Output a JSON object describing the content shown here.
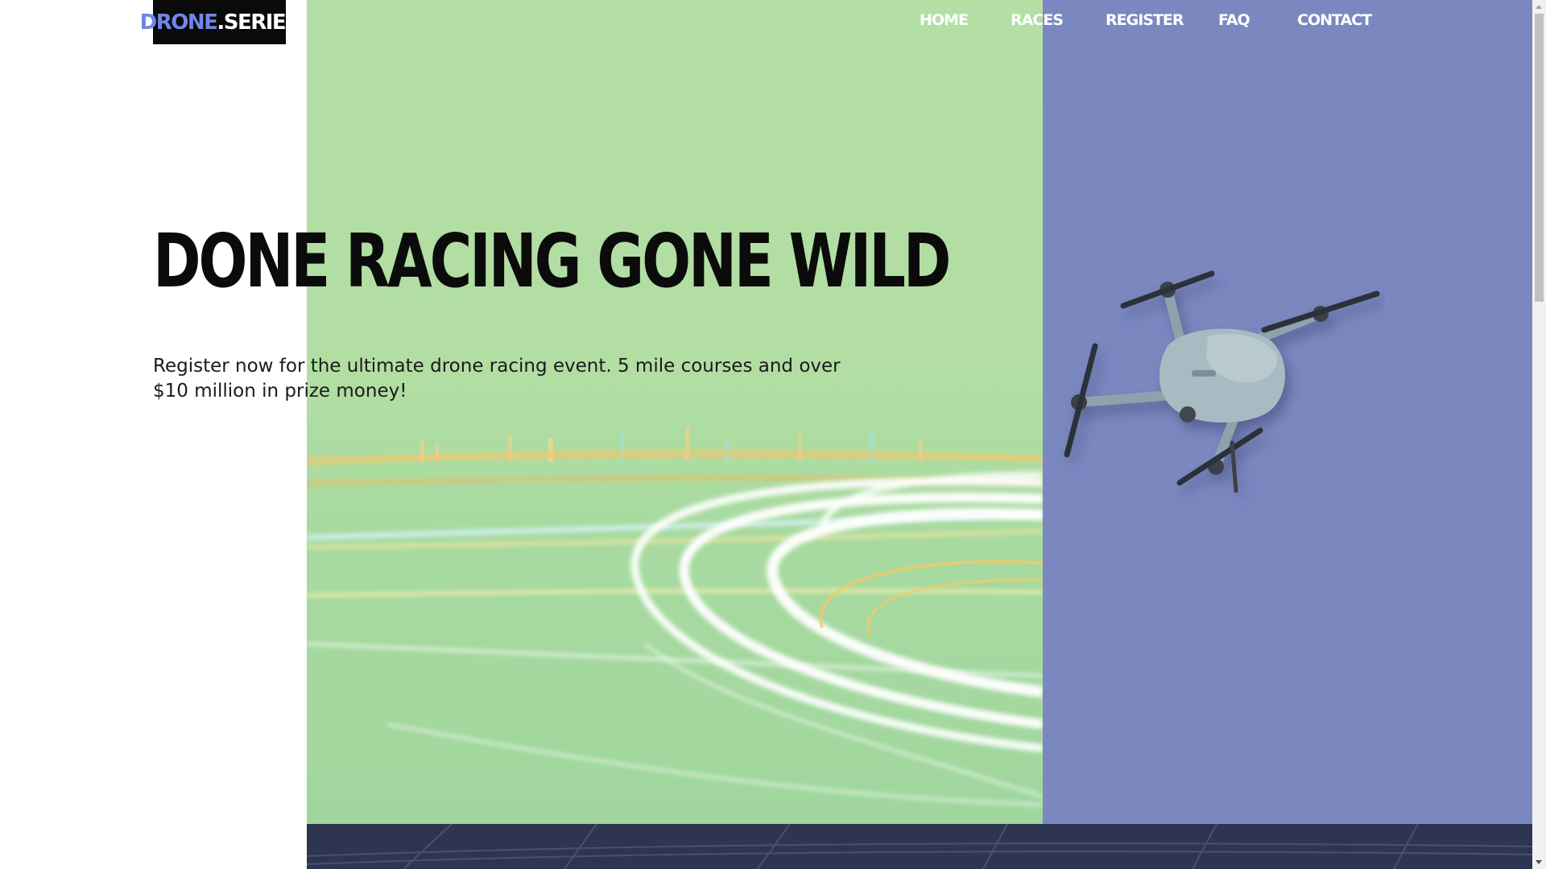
{
  "logo": {
    "part1": "DRONE",
    "part2": ".SERIES"
  },
  "nav": {
    "items": [
      {
        "label": "HOME"
      },
      {
        "label": "RACES"
      },
      {
        "label": "REGISTER"
      },
      {
        "label": "FAQ"
      },
      {
        "label": "CONTACT"
      }
    ]
  },
  "hero": {
    "headline": "DONE RACING GONE WILD",
    "subtext": "Register now for the ultimate drone racing event. 5 mile courses and over $10 million in prize money!",
    "image_icon": "light-trails-photo",
    "drone_icon": "drone-quadcopter"
  },
  "colors": {
    "hero_green": "#b3dfa4",
    "panel_purple": "#7b88c0",
    "logo_accent": "#6f86e8",
    "bottom_band": "#2d3550"
  }
}
